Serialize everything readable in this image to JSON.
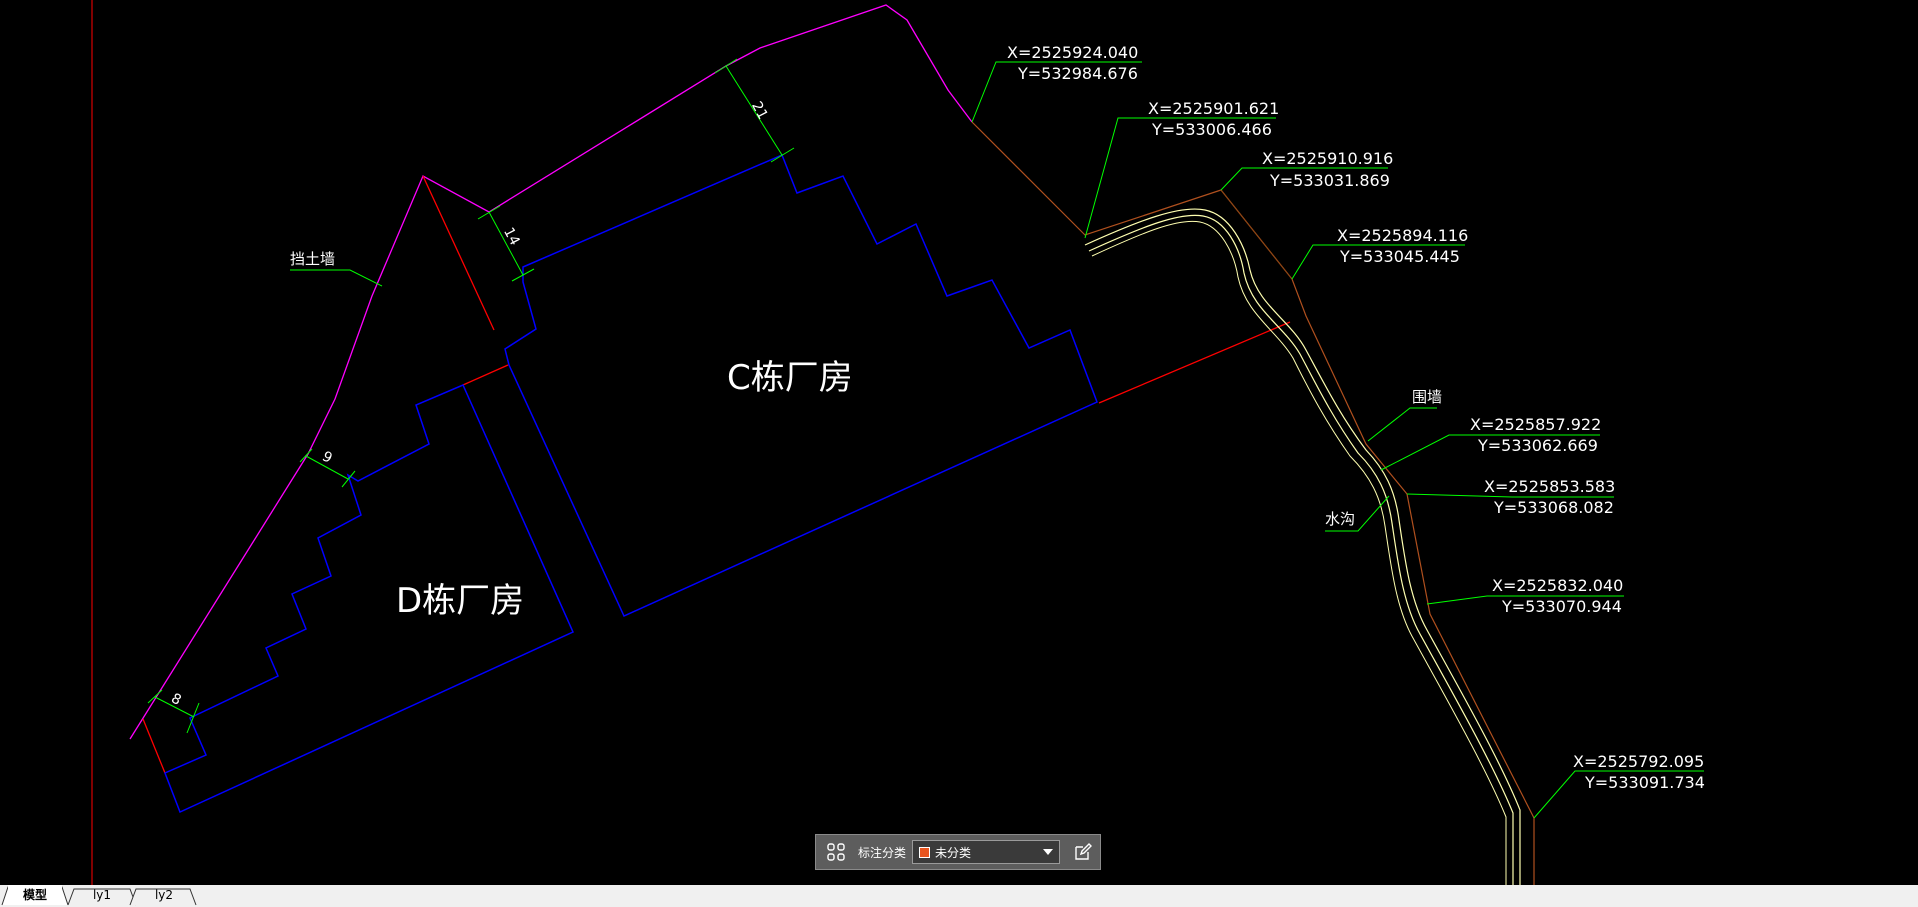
{
  "drawing": {
    "building_c": "C栋厂房",
    "building_d": "D栋厂房",
    "retaining_wall_label": "挡土墙",
    "boundary_wall_label": "围墙",
    "ditch_label": "水沟",
    "dimensions": [
      "21",
      "14",
      "9",
      "8"
    ],
    "coordinates": [
      {
        "x": "X=2525924.040",
        "y": "Y=532984.676"
      },
      {
        "x": "X=2525901.621",
        "y": "Y=533006.466"
      },
      {
        "x": "X=2525910.916",
        "y": "Y=533031.869"
      },
      {
        "x": "X=2525894.116",
        "y": "Y=533045.445"
      },
      {
        "x": "X=2525857.922",
        "y": "Y=533062.669"
      },
      {
        "x": "X=2525853.583",
        "y": "Y=533068.082"
      },
      {
        "x": "X=2525832.040",
        "y": "Y=533070.944"
      },
      {
        "x": "X=2525792.095",
        "y": "Y=533091.734"
      }
    ],
    "colors": {
      "background": "#000000",
      "boundary": "#ff00ff",
      "building": "#0000ff",
      "red_line": "#ff0000",
      "annotation": "#00ff00",
      "wall": "#8b4513",
      "ditch": "#ffff99"
    }
  },
  "toolbar": {
    "grid_icon": "grid-icon",
    "label": "标注分类",
    "selected": "未分类",
    "swatch_color": "#e8541e",
    "edit_icon": "edit-icon"
  },
  "tabs": [
    "模型",
    "ly1",
    "ly2"
  ]
}
